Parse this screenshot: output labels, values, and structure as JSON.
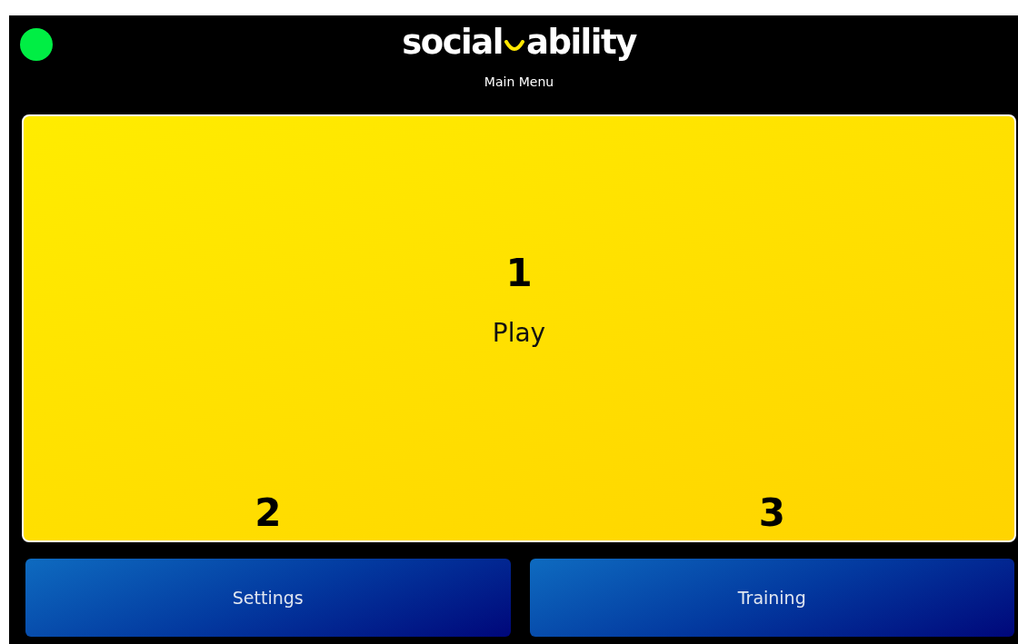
{
  "header": {
    "status": {
      "color": "#00ee44"
    },
    "logo": {
      "left": "social",
      "right": "ability"
    },
    "title": "Main Menu"
  },
  "play": {
    "number": "1",
    "label": "Play"
  },
  "buttons": [
    {
      "number": "2",
      "label": "Settings"
    },
    {
      "number": "3",
      "label": "Training"
    }
  ]
}
